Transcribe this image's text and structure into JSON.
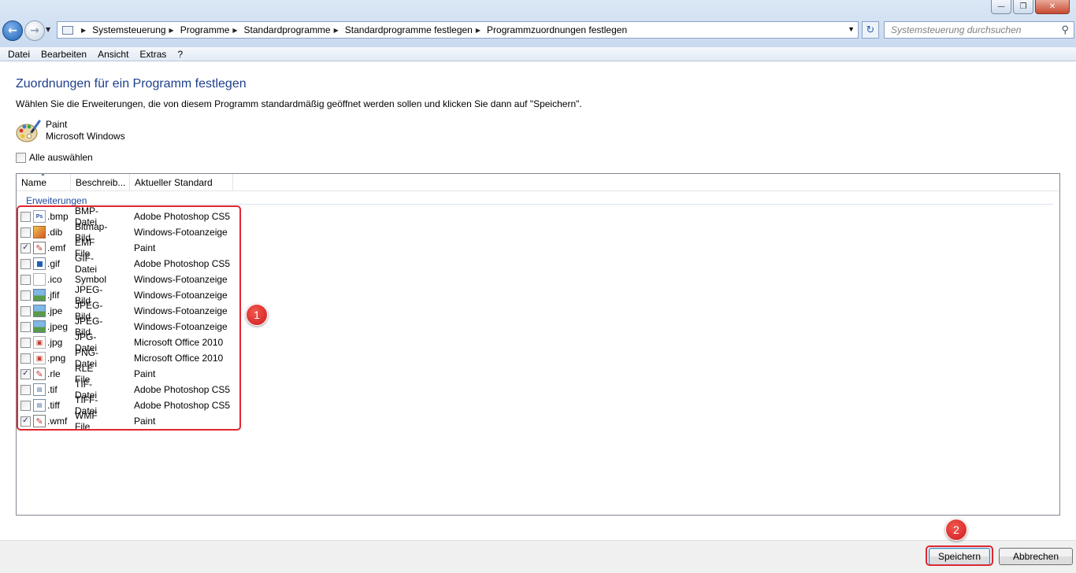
{
  "address": {
    "crumbs": [
      "Systemsteuerung",
      "Programme",
      "Standardprogramme",
      "Standardprogramme festlegen",
      "Programmzuordnungen festlegen"
    ],
    "search_placeholder": "Systemsteuerung durchsuchen"
  },
  "menu": [
    "Datei",
    "Bearbeiten",
    "Ansicht",
    "Extras",
    "?"
  ],
  "page": {
    "title": "Zuordnungen für ein Programm festlegen",
    "description": "Wählen Sie die Erweiterungen, die von diesem Programm standardmäßig geöffnet werden sollen und klicken Sie dann auf \"Speichern\".",
    "program_name": "Paint",
    "program_vendor": "Microsoft Windows",
    "select_all_label": "Alle auswählen"
  },
  "list": {
    "columns": [
      "Name",
      "Beschreib...",
      "Aktueller Standard"
    ],
    "group_label": "Erweiterungen",
    "rows": [
      {
        "ext": ".bmp",
        "desc": "BMP-Datei",
        "std": "Adobe Photoshop CS5",
        "checked": false,
        "icon": "photoshop-file-icon"
      },
      {
        "ext": ".dib",
        "desc": "Bitmap-Bild",
        "std": "Windows-Fotoanzeige",
        "checked": false,
        "icon": "bitmap-file-icon"
      },
      {
        "ext": ".emf",
        "desc": "EMF File",
        "std": "Paint",
        "checked": true,
        "icon": "paint-file-icon"
      },
      {
        "ext": ".gif",
        "desc": "GIF-Datei",
        "std": "Adobe Photoshop CS5",
        "checked": false,
        "icon": "gif-file-icon"
      },
      {
        "ext": ".ico",
        "desc": "Symbol",
        "std": "Windows-Fotoanzeige",
        "checked": false,
        "icon": "blank-file-icon"
      },
      {
        "ext": ".jfif",
        "desc": "JPEG-Bild",
        "std": "Windows-Fotoanzeige",
        "checked": false,
        "icon": "photo-file-icon"
      },
      {
        "ext": ".jpe",
        "desc": "JPEG-Bild",
        "std": "Windows-Fotoanzeige",
        "checked": false,
        "icon": "photo-file-icon"
      },
      {
        "ext": ".jpeg",
        "desc": "JPEG-Bild",
        "std": "Windows-Fotoanzeige",
        "checked": false,
        "icon": "photo-file-icon"
      },
      {
        "ext": ".jpg",
        "desc": "JPG-Datei",
        "std": "Microsoft Office 2010",
        "checked": false,
        "icon": "office-file-icon"
      },
      {
        "ext": ".png",
        "desc": "PNG-Datei",
        "std": "Microsoft Office 2010",
        "checked": false,
        "icon": "office-file-icon"
      },
      {
        "ext": ".rle",
        "desc": "RLE File",
        "std": "Paint",
        "checked": true,
        "icon": "paint-file-icon"
      },
      {
        "ext": ".tif",
        "desc": "TIF-Datei",
        "std": "Adobe Photoshop CS5",
        "checked": false,
        "icon": "tif-file-icon"
      },
      {
        "ext": ".tiff",
        "desc": "TIFF-Datei",
        "std": "Adobe Photoshop CS5",
        "checked": false,
        "icon": "tif-file-icon"
      },
      {
        "ext": ".wmf",
        "desc": "WMF File",
        "std": "Paint",
        "checked": true,
        "icon": "paint-file-icon"
      }
    ]
  },
  "annotations": {
    "badge1": "1",
    "badge2": "2",
    "color": "#e1262f"
  },
  "buttons": {
    "save": "Speichern",
    "cancel": "Abbrechen"
  }
}
